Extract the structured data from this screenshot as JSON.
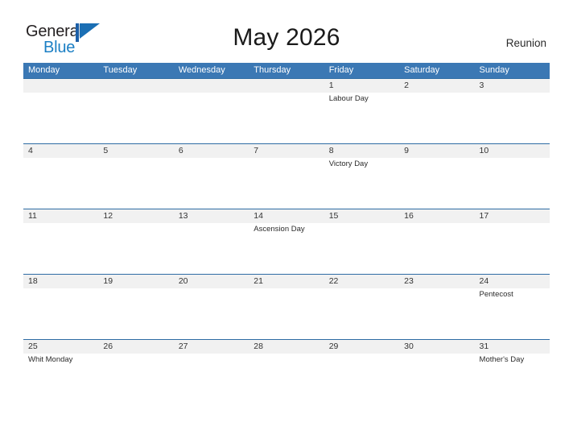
{
  "brand": {
    "name_part1": "General",
    "name_part2": "Blue",
    "flag_icon": "blue-flag-triangle",
    "accent_color": "#1b7fc4"
  },
  "header": {
    "title": "May 2026",
    "region": "Reunion"
  },
  "theme": {
    "header_blue": "#3b78b4",
    "row_divider_blue": "#2e6ca4",
    "date_strip_gray": "#f1f1f1",
    "text_dark": "#333333"
  },
  "calendar": {
    "day_headers": [
      "Monday",
      "Tuesday",
      "Wednesday",
      "Thursday",
      "Friday",
      "Saturday",
      "Sunday"
    ],
    "weeks": [
      {
        "days": [
          {
            "date": "",
            "event": ""
          },
          {
            "date": "",
            "event": ""
          },
          {
            "date": "",
            "event": ""
          },
          {
            "date": "",
            "event": ""
          },
          {
            "date": "1",
            "event": "Labour Day"
          },
          {
            "date": "2",
            "event": ""
          },
          {
            "date": "3",
            "event": ""
          }
        ]
      },
      {
        "days": [
          {
            "date": "4",
            "event": ""
          },
          {
            "date": "5",
            "event": ""
          },
          {
            "date": "6",
            "event": ""
          },
          {
            "date": "7",
            "event": ""
          },
          {
            "date": "8",
            "event": "Victory Day"
          },
          {
            "date": "9",
            "event": ""
          },
          {
            "date": "10",
            "event": ""
          }
        ]
      },
      {
        "days": [
          {
            "date": "11",
            "event": ""
          },
          {
            "date": "12",
            "event": ""
          },
          {
            "date": "13",
            "event": ""
          },
          {
            "date": "14",
            "event": "Ascension Day"
          },
          {
            "date": "15",
            "event": ""
          },
          {
            "date": "16",
            "event": ""
          },
          {
            "date": "17",
            "event": ""
          }
        ]
      },
      {
        "days": [
          {
            "date": "18",
            "event": ""
          },
          {
            "date": "19",
            "event": ""
          },
          {
            "date": "20",
            "event": ""
          },
          {
            "date": "21",
            "event": ""
          },
          {
            "date": "22",
            "event": ""
          },
          {
            "date": "23",
            "event": ""
          },
          {
            "date": "24",
            "event": "Pentecost"
          }
        ]
      },
      {
        "days": [
          {
            "date": "25",
            "event": "Whit Monday"
          },
          {
            "date": "26",
            "event": ""
          },
          {
            "date": "27",
            "event": ""
          },
          {
            "date": "28",
            "event": ""
          },
          {
            "date": "29",
            "event": ""
          },
          {
            "date": "30",
            "event": ""
          },
          {
            "date": "31",
            "event": "Mother's Day"
          }
        ]
      }
    ]
  }
}
